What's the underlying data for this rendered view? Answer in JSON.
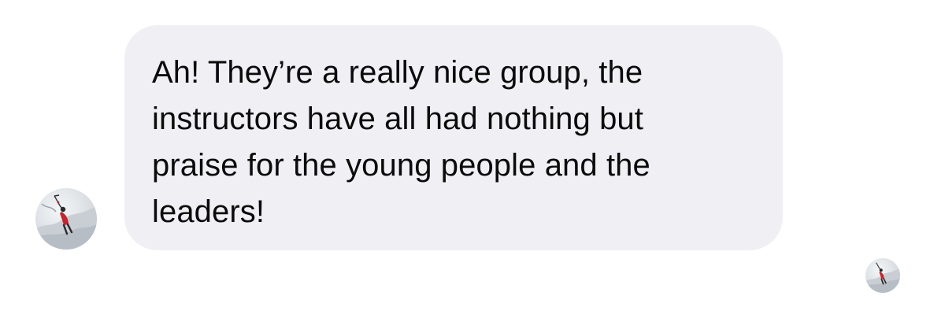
{
  "conversation": {
    "message": {
      "text": "Ah! They’re a really nice group, the\ninstructors have all had nothing but\npraise for the young people and the\nleaders!"
    },
    "sender_avatar": {
      "icon": "climber-avatar-icon"
    },
    "read_receipt": {
      "icon": "climber-avatar-icon"
    }
  },
  "colors": {
    "bubble_background": "#f0f0f4",
    "text": "#0b0b0b",
    "page_background": "#ffffff"
  }
}
